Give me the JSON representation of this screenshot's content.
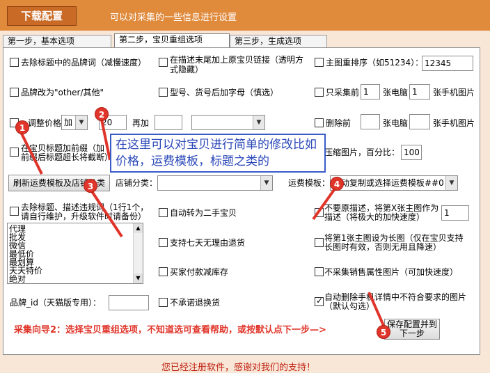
{
  "header": {
    "button": "下载配置",
    "description": "可以对采集的一些信息进行设置"
  },
  "tabs": [
    "第一步，基本选项",
    "第二步，宝贝重组选项",
    "第三步，生成选项"
  ],
  "options": {
    "remove_brand": "去除标题中的品牌词（减慢速度）",
    "append_link": "在描述末尾加上原宝贝链接（透明方式隐藏）",
    "main_image_sort": "主图重排序（如51234）：",
    "main_image_sort_value": "12345",
    "brand_other": "品牌改为\"other/其他\"",
    "model_suffix": "型号、货号后加字母（慎选）",
    "collect_first": "只采集前",
    "pc_images": "张电脑",
    "pc_value": "1",
    "mobile_value": "1",
    "mobile_images": "张手机图片",
    "adjust_price": "调整价格",
    "price_op": "加",
    "price_value": "20",
    "add_again": "再加",
    "delete_first": "删除前",
    "pc_images2": "张电脑",
    "mobile_images2": "张手机图片",
    "prefix_title": "在宝贝标题加前缀（加前缀后标题超长将截断）",
    "compress": "压缩图片，百分比：",
    "compress_value": "100",
    "refresh_button": "刷新运费模板及店铺分类",
    "shop_category": "店铺分类：",
    "freight_template": "运费模板：",
    "freight_value": "自动复制或选择运费模板##0",
    "remove_keywords": "去除标题、描述违规词（1行1个，请自行维护，升级软件时请备份）",
    "keywords": [
      "代理",
      "批发",
      "微信",
      "最低价",
      "最划算",
      "天天特价",
      "绝对"
    ],
    "second_hand": "自动转为二手宝贝",
    "no_desc": "不要原描述，将第X张主图作为描述（将极大的加快速度）",
    "no_desc_value": "1",
    "seven_days": "支持七天无理由退货",
    "long_image": "将第1张主图设为长图（仅在宝贝支持长图时有效，否则无用且降速）",
    "buyer_pay": "买家付款减库存",
    "no_sales_attr": "不采集销售属性图片（可加快速度）",
    "brand_id": "品牌_id（天猫版专用）：",
    "no_return": "不承诺退换货",
    "auto_delete": "自动删除手机详情中不符合要求的图片（默认勾选）",
    "save_button": "保存配置并到下一步"
  },
  "callout": "在这里可以对宝贝进行简单的修改比如价格，运费模板，标题之类的",
  "guide": "采集向导2：选择宝贝重组选项，不知道选可查看帮助，或按默认点下一步—>",
  "footer": "您已经注册软件，感谢对我们的支持！",
  "badges": [
    "1",
    "2",
    "3",
    "4",
    "5"
  ],
  "colors": {
    "header": "#e08a3c",
    "badge": "#e0352a",
    "callout": "#3a5bc6",
    "guide": "#e0352a"
  }
}
